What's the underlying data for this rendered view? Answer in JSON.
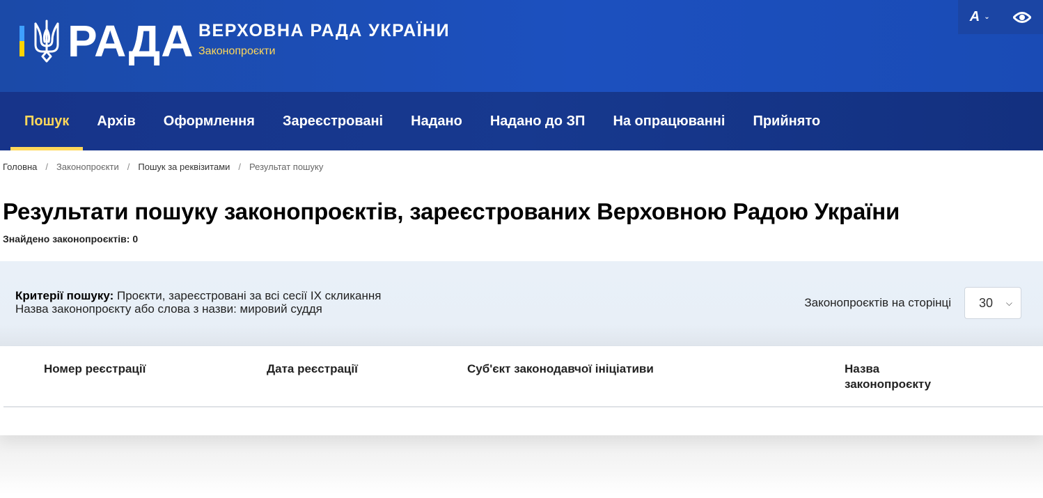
{
  "header": {
    "logo_text": "РАДА",
    "title": "ВЕРХОВНА РАДА УКРАЇНИ",
    "subtitle": "Законопроєкти",
    "font_size_button": "A",
    "colors": {
      "flag_blue": "#3ea0ff",
      "flag_yellow": "#ffd300",
      "accent": "#ffd85a",
      "header_bg": "#1c50bf",
      "nav_bg": "#17398f"
    },
    "icons": [
      "trident-icon",
      "chevron-down-icon",
      "eye-icon"
    ]
  },
  "nav": {
    "items": [
      {
        "label": "Пошук",
        "active": true
      },
      {
        "label": "Архів"
      },
      {
        "label": "Оформлення"
      },
      {
        "label": "Зареєстровані"
      },
      {
        "label": "Надано"
      },
      {
        "label": "Надано до ЗП"
      },
      {
        "label": "На опрацюванні"
      },
      {
        "label": "Прийнято"
      }
    ]
  },
  "breadcrumb": {
    "items": [
      "Головна",
      "Законопроєкти",
      "Пошук за реквізитами",
      "Результат пошуку"
    ],
    "separator": "/"
  },
  "main": {
    "title": "Результати пошуку законопроєктів, зареєстрованих Верховною Радою України",
    "found_text": "Знайдено законопроєктів: 0"
  },
  "criteria": {
    "label": "Критерії пошуку:",
    "line1": " Проєкти, зареєстровані за всі сесії IX скликання",
    "line2": "Назва законопроєкту або слова з назви: мировий суддя",
    "per_page_label": "Законопроєктів на сторінці",
    "per_page_value": "30"
  },
  "table": {
    "columns": [
      "Номер реєстрації",
      "Дата реєстрації",
      "Суб'єкт законодавчої ініціативи",
      "Назва законопроєкту"
    ],
    "rows": []
  }
}
